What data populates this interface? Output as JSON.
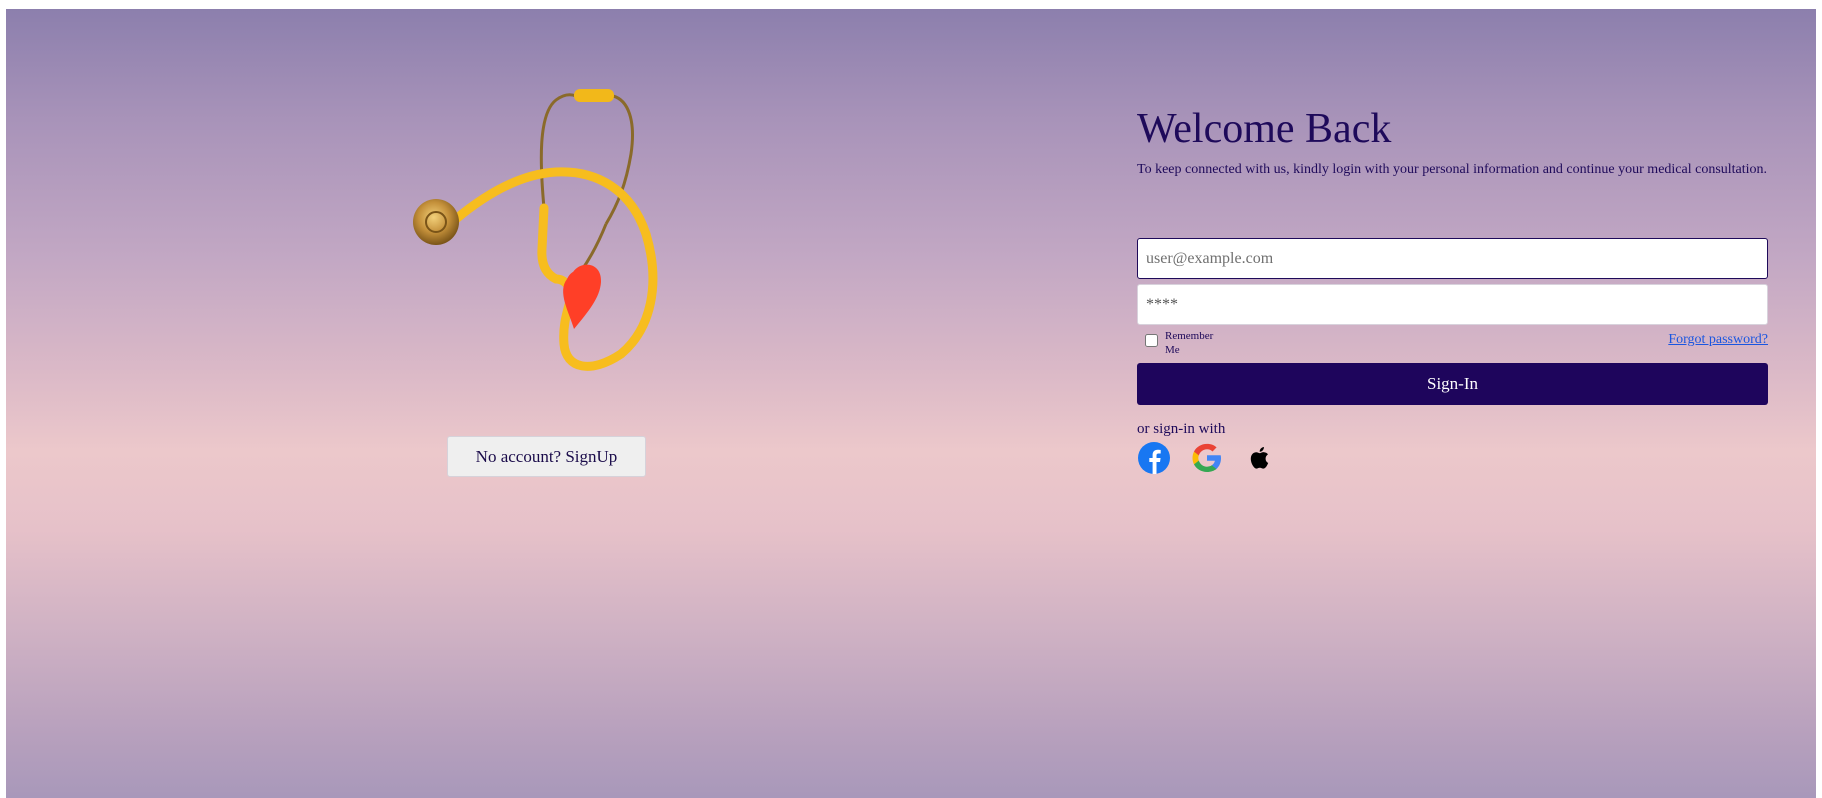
{
  "signup_button_label": "No account? SignUp",
  "welcome": {
    "title": "Welcome Back",
    "subtitle": "To keep connected with us, kindly login with your personal information and continue your medical consultation."
  },
  "form": {
    "email_placeholder": "user@example.com",
    "password_value": "****",
    "remember_label": "Remember Me",
    "forgot_label": "Forgot password?",
    "signin_label": "Sign-In",
    "or_text": "or sign-in with"
  },
  "social": [
    "facebook-icon",
    "google-icon",
    "apple-icon"
  ],
  "colors": {
    "primary": "#1e055c",
    "link": "#1a56e0",
    "heart": "#ff3f27",
    "stethoscope": "#f7bd1e"
  }
}
